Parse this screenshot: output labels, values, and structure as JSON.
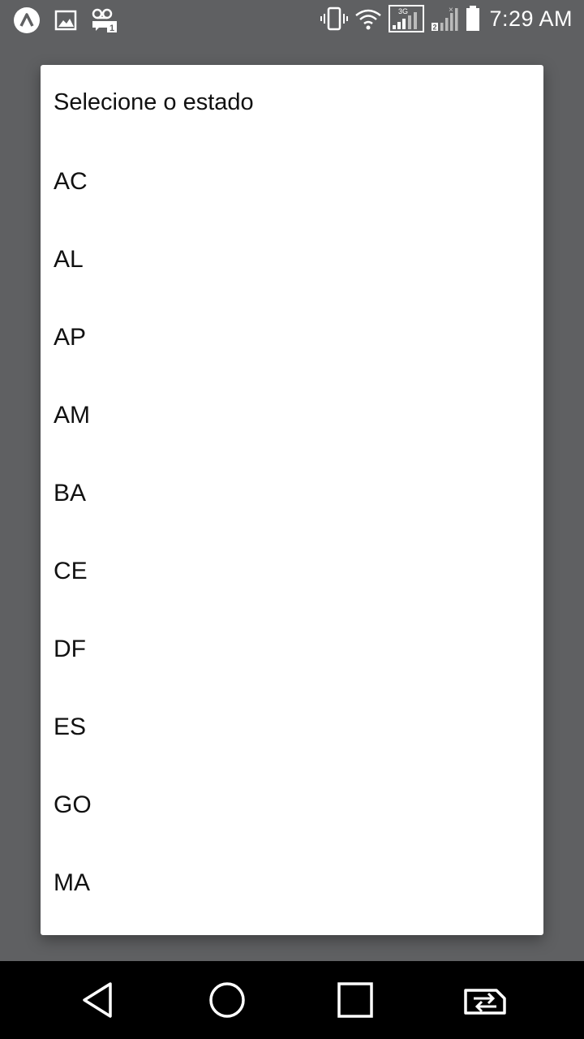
{
  "status_bar": {
    "time": "7:29 AM",
    "network_label": "3G",
    "left_icons": [
      "app-logo-icon",
      "image-notification-icon",
      "voicemail-sim-icon"
    ],
    "right_icons": [
      "vibrate-icon",
      "wifi-icon",
      "signal-3g-icon",
      "signal-sim2-icon",
      "battery-icon"
    ]
  },
  "dialog": {
    "title": "Selecione o estado",
    "options": [
      "AC",
      "AL",
      "AP",
      "AM",
      "BA",
      "CE",
      "DF",
      "ES",
      "GO",
      "MA"
    ]
  },
  "nav_bar": {
    "icons": [
      "back-icon",
      "home-icon",
      "recents-icon",
      "switch-sim-icon"
    ]
  },
  "colors": {
    "scrim": "#5f6062",
    "dialog_bg": "#ffffff",
    "text": "#111111",
    "nav_bg": "#000000"
  }
}
